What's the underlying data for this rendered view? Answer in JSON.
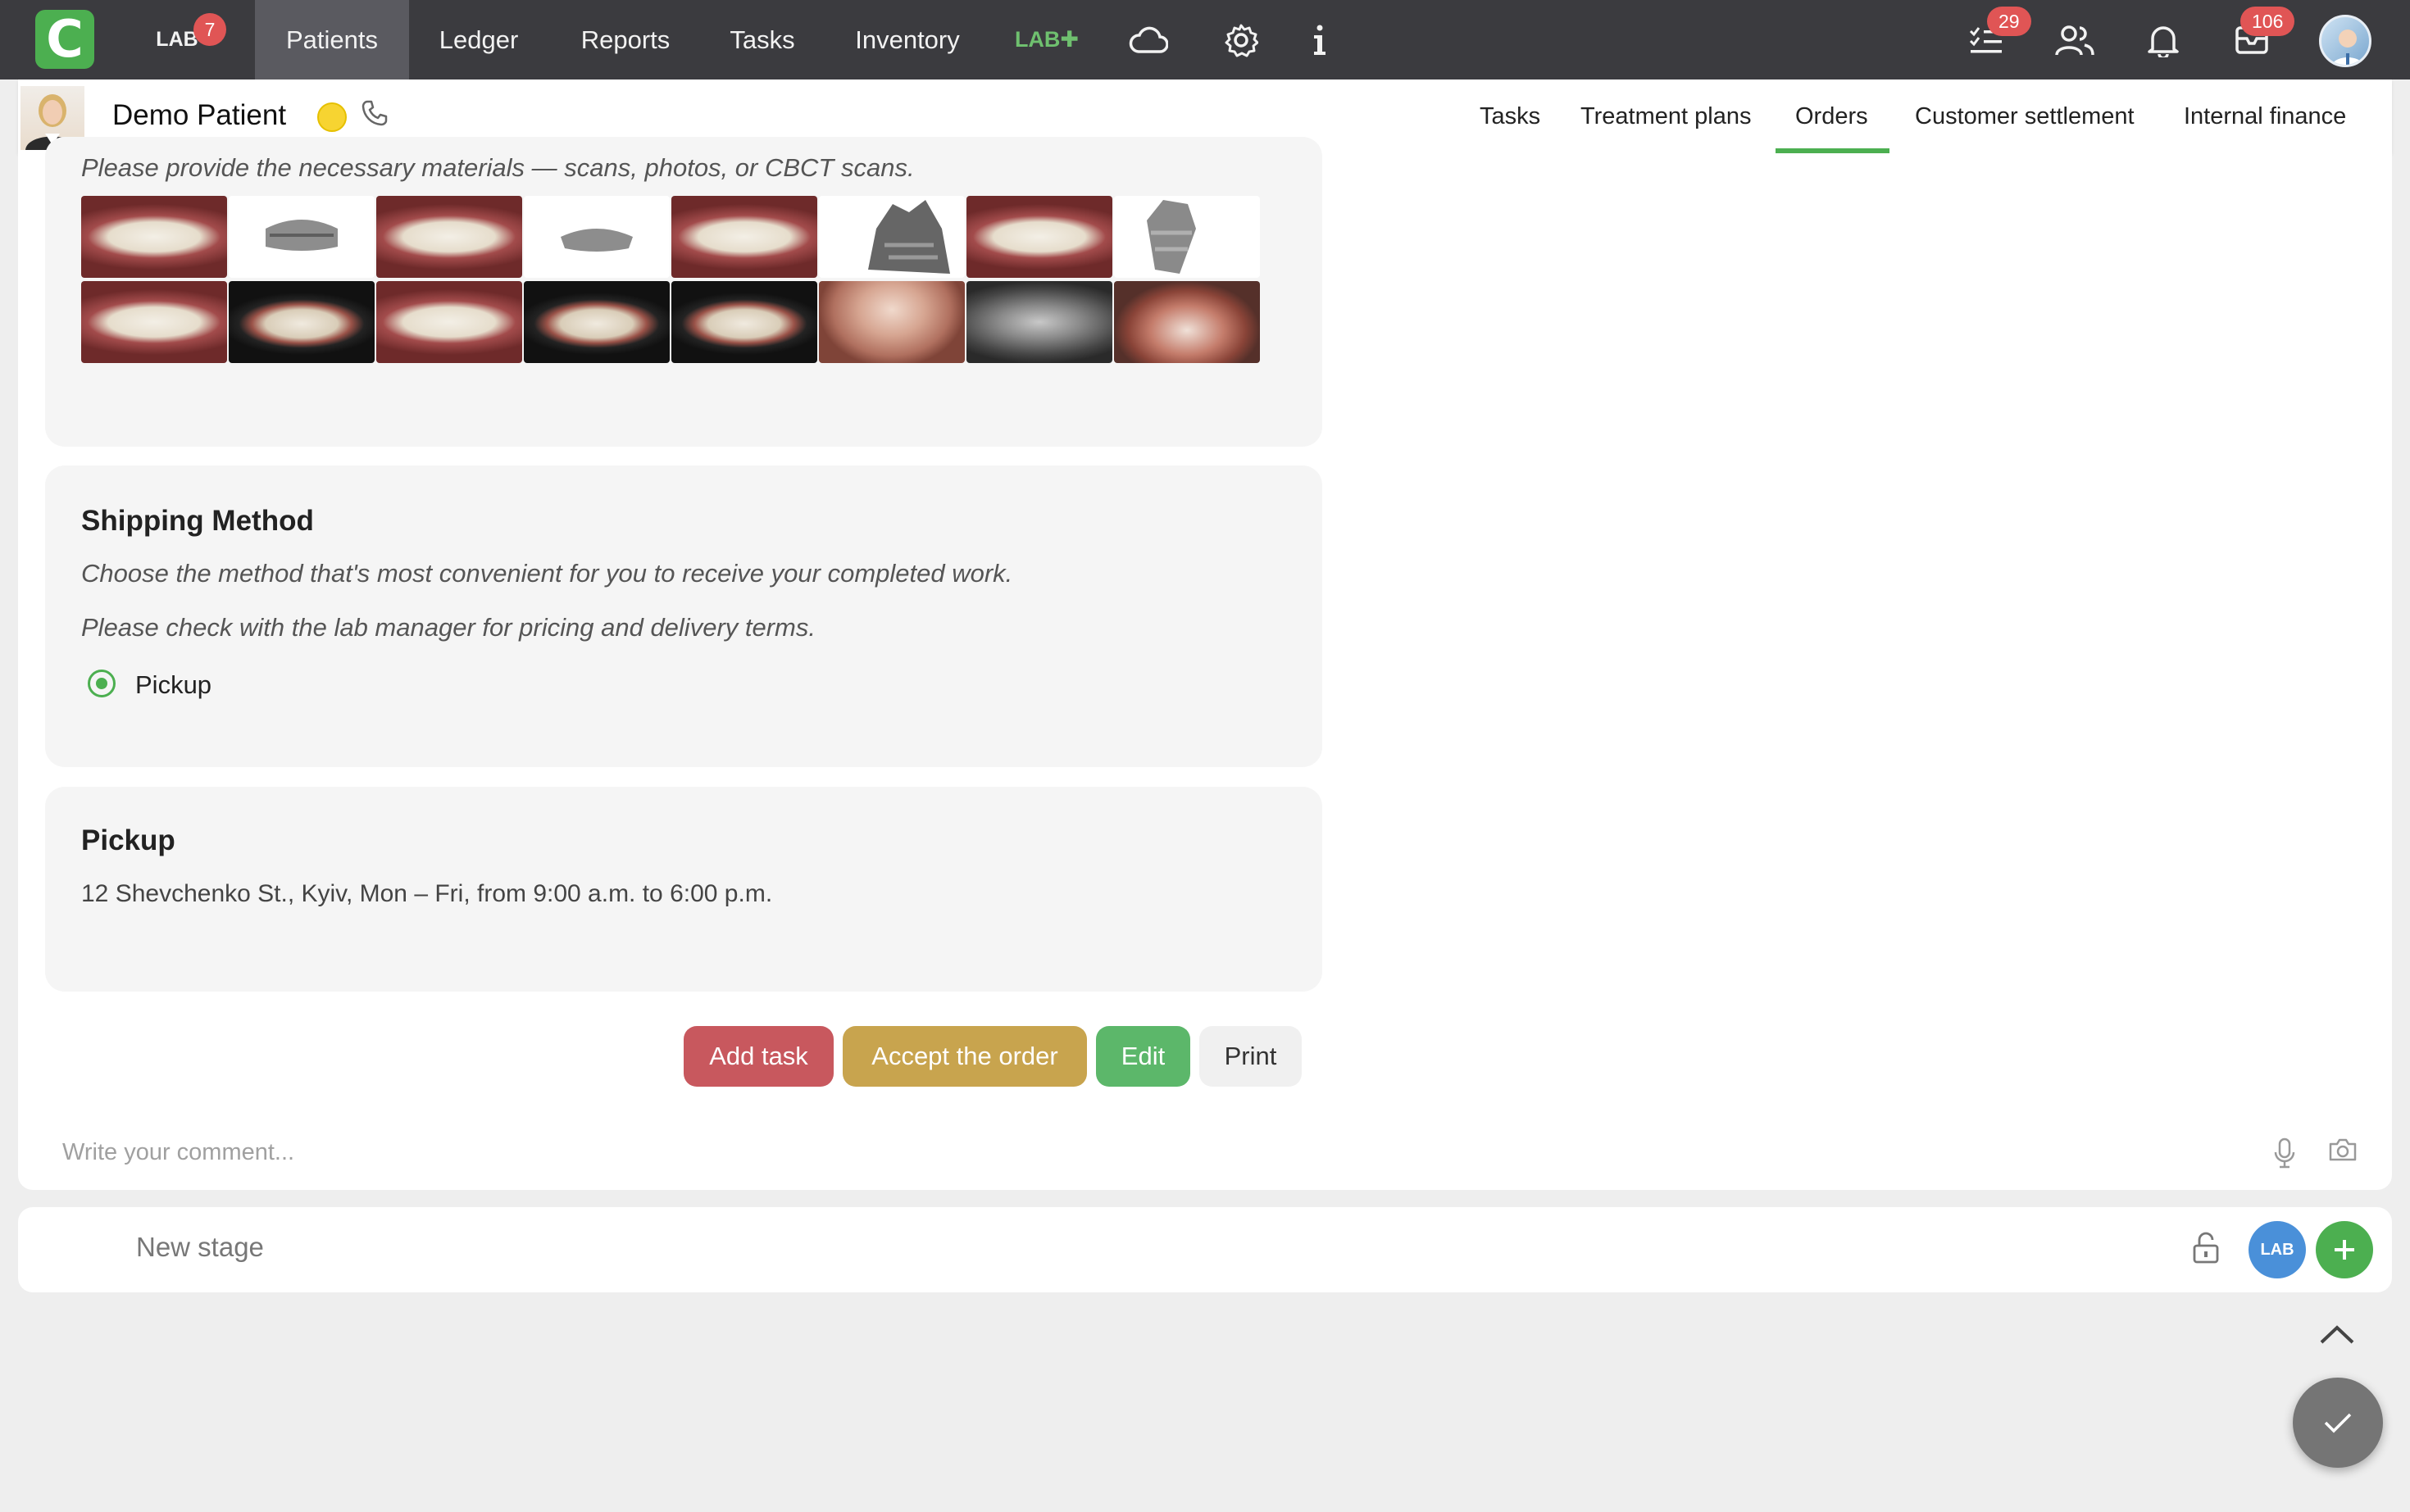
{
  "nav": {
    "lab_label": "LAB",
    "lab_badge": "7",
    "items": [
      "Patients",
      "Ledger",
      "Reports",
      "Tasks",
      "Inventory"
    ],
    "labplus_label": "LAB✚",
    "tasks_badge": "29",
    "messages_badge": "106",
    "icons": [
      "cloud-icon",
      "gear-icon",
      "info-icon",
      "task-list-icon",
      "users-icon",
      "bell-icon",
      "mail-icon"
    ]
  },
  "patient": {
    "name": "Demo Patient",
    "tabs": [
      "Tasks",
      "Treatment plans",
      "Orders",
      "Customer settlement",
      "Internal finance"
    ],
    "active_tab": "Orders"
  },
  "materials": {
    "hint": "Please provide the necessary materials — scans, photos, or CBCT scans."
  },
  "shipping": {
    "title": "Shipping Method",
    "line1": "Choose the method that's most convenient for you to receive your completed work.",
    "line2": "Please check with the lab manager for pricing and delivery terms.",
    "option": "Pickup"
  },
  "pickup": {
    "title": "Pickup",
    "address": "12 Shevchenko St., Kyiv, Mon – Fri, from 9:00 a.m. to 6:00 p.m."
  },
  "actions": {
    "add_task": "Add task",
    "accept": "Accept the order",
    "edit": "Edit",
    "print": "Print"
  },
  "comment": {
    "placeholder": "Write your comment..."
  },
  "stage": {
    "label": "New stage",
    "lab_badge": "LAB"
  },
  "colors": {
    "nav_bg": "#3b3b3f",
    "accent": "#4caf50",
    "add_task": "#c8585e",
    "accept": "#c8a44e",
    "edit": "#5cb76a",
    "badge": "#e05555"
  }
}
